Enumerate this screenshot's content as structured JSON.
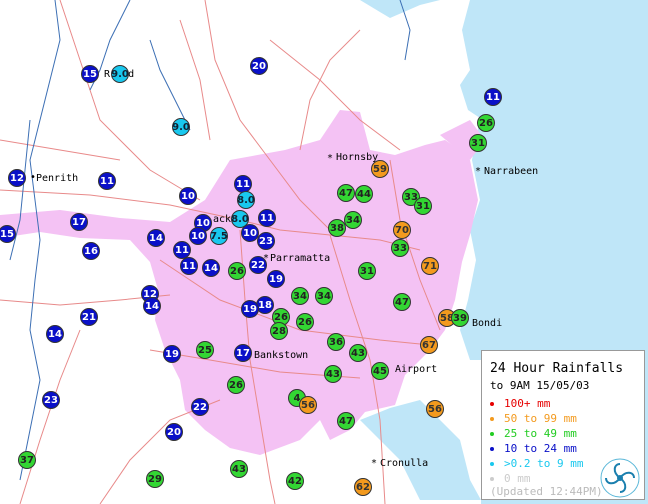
{
  "colors": {
    "sea": "#bfe6f8",
    "urban": "#f4c2f4",
    "roads": "#e88a8a",
    "rivers": "#3c6fb4"
  },
  "places": [
    {
      "id": "penrith",
      "label": "Penrith",
      "marker": "dot"
    },
    {
      "id": "richmond",
      "label": "R      ond",
      "marker": "none"
    },
    {
      "id": "hornsby",
      "label": "Hornsby",
      "marker": "star"
    },
    {
      "id": "narrabeen",
      "label": "Narrabeen",
      "marker": "star"
    },
    {
      "id": "blacktown",
      "label": "ack",
      "marker": "none"
    },
    {
      "id": "parramatta",
      "label": "Parramatta",
      "marker": "star"
    },
    {
      "id": "bankstown",
      "label": "Bankstown",
      "marker": "none"
    },
    {
      "id": "airport",
      "label": "Airport",
      "marker": "none"
    },
    {
      "id": "bondi",
      "label": "Bondi",
      "marker": "none"
    },
    {
      "id": "cronulla",
      "label": "Cronulla",
      "marker": "star"
    }
  ],
  "gauges": [
    {
      "v": "15",
      "c": "blue"
    },
    {
      "v": "9.0",
      "c": "cyan"
    },
    {
      "v": "20",
      "c": "blue"
    },
    {
      "v": "9.0",
      "c": "cyan"
    },
    {
      "v": "11",
      "c": "blue"
    },
    {
      "v": "26",
      "c": "green"
    },
    {
      "v": "31",
      "c": "green"
    },
    {
      "v": "12",
      "c": "blue"
    },
    {
      "v": "11",
      "c": "blue"
    },
    {
      "v": "10",
      "c": "blue"
    },
    {
      "v": "11",
      "c": "blue"
    },
    {
      "v": "8.0",
      "c": "cyan"
    },
    {
      "v": "59",
      "c": "orange"
    },
    {
      "v": "47",
      "c": "green"
    },
    {
      "v": "44",
      "c": "green"
    },
    {
      "v": "33",
      "c": "green"
    },
    {
      "v": "31",
      "c": "green"
    },
    {
      "v": "17",
      "c": "blue"
    },
    {
      "v": "10",
      "c": "blue"
    },
    {
      "v": "8.0",
      "c": "cyan"
    },
    {
      "v": "11",
      "c": "blue"
    },
    {
      "v": "34",
      "c": "green"
    },
    {
      "v": "15",
      "c": "blue"
    },
    {
      "v": "16",
      "c": "blue"
    },
    {
      "v": "14",
      "c": "blue"
    },
    {
      "v": "10",
      "c": "blue"
    },
    {
      "v": "7.5",
      "c": "cyan"
    },
    {
      "v": "10",
      "c": "blue"
    },
    {
      "v": "23",
      "c": "blue"
    },
    {
      "v": "38",
      "c": "green"
    },
    {
      "v": "70",
      "c": "orange"
    },
    {
      "v": "33",
      "c": "green"
    },
    {
      "v": "11",
      "c": "blue"
    },
    {
      "v": "11",
      "c": "blue"
    },
    {
      "v": "14",
      "c": "blue"
    },
    {
      "v": "26",
      "c": "green"
    },
    {
      "v": "22",
      "c": "blue"
    },
    {
      "v": "19",
      "c": "blue"
    },
    {
      "v": "31",
      "c": "green"
    },
    {
      "v": "71",
      "c": "orange"
    },
    {
      "v": "12",
      "c": "blue"
    },
    {
      "v": "14",
      "c": "blue"
    },
    {
      "v": "34",
      "c": "green"
    },
    {
      "v": "34",
      "c": "green"
    },
    {
      "v": "18",
      "c": "blue"
    },
    {
      "v": "19",
      "c": "blue"
    },
    {
      "v": "47",
      "c": "green"
    },
    {
      "v": "14",
      "c": "blue"
    },
    {
      "v": "21",
      "c": "blue"
    },
    {
      "v": "26",
      "c": "green"
    },
    {
      "v": "28",
      "c": "green"
    },
    {
      "v": "26",
      "c": "green"
    },
    {
      "v": "58",
      "c": "orange"
    },
    {
      "v": "39",
      "c": "green"
    },
    {
      "v": "36",
      "c": "green"
    },
    {
      "v": "67",
      "c": "orange"
    },
    {
      "v": "19",
      "c": "blue"
    },
    {
      "v": "25",
      "c": "green"
    },
    {
      "v": "17",
      "c": "blue"
    },
    {
      "v": "43",
      "c": "green"
    },
    {
      "v": "43",
      "c": "green"
    },
    {
      "v": "45",
      "c": "green"
    },
    {
      "v": "23",
      "c": "blue"
    },
    {
      "v": "26",
      "c": "green"
    },
    {
      "v": "4",
      "c": "green"
    },
    {
      "v": "56",
      "c": "orange"
    },
    {
      "v": "22",
      "c": "blue"
    },
    {
      "v": "56",
      "c": "orange"
    },
    {
      "v": "47",
      "c": "green"
    },
    {
      "v": "20",
      "c": "blue"
    },
    {
      "v": "37",
      "c": "green"
    },
    {
      "v": "29",
      "c": "green"
    },
    {
      "v": "43",
      "c": "green"
    },
    {
      "v": "42",
      "c": "green"
    },
    {
      "v": "62",
      "c": "orange"
    }
  ],
  "legend": {
    "title": "24 Hour Rainfalls",
    "subtitle": "to 9AM 15/05/03",
    "ranges": [
      {
        "label": "100+ mm",
        "color": "#e60000"
      },
      {
        "label": "50 to 99 mm",
        "color": "#f39a1e"
      },
      {
        "label": "25 to 49 mm",
        "color": "#22cc22"
      },
      {
        "label": "10 to 24 mm",
        "color": "#0a10c8"
      },
      {
        "label": ">0.2 to 9 mm",
        "color": "#19c8ee"
      },
      {
        "label": "0 mm",
        "color": "#cccccc"
      }
    ],
    "updated": "(Updated 12:44PM)"
  }
}
